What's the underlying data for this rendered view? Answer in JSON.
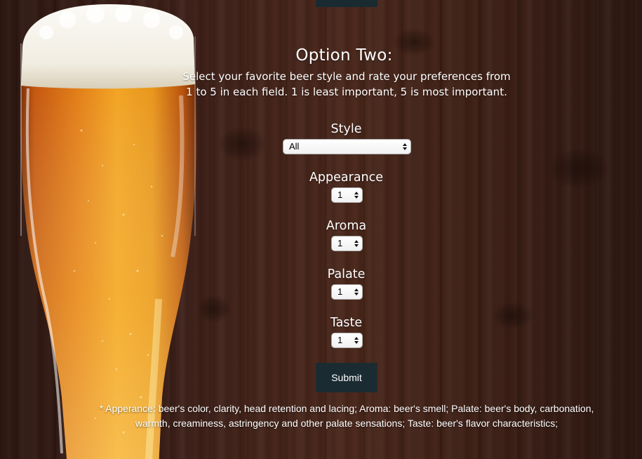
{
  "form": {
    "title": "Option Two:",
    "description": "Select your favorite beer style and rate your preferences from 1 to 5 in each field. 1 is least important, 5 is most important.",
    "fields": [
      {
        "label": "Style",
        "value": "All"
      },
      {
        "label": "Appearance",
        "value": "1"
      },
      {
        "label": "Aroma",
        "value": "1"
      },
      {
        "label": "Palate",
        "value": "1"
      },
      {
        "label": "Taste",
        "value": "1"
      }
    ],
    "submit_label": "Submit",
    "footnote": "* Apperance: beer's color, clarity, head retention and lacing; Aroma: beer's smell; Palate: beer's body, carbonation, warmth, creaminess, astringency and other palate sensations; Taste: beer's flavor characteristics;"
  },
  "colors": {
    "button_bg": "#1b2b32",
    "text": "#ffffff"
  }
}
